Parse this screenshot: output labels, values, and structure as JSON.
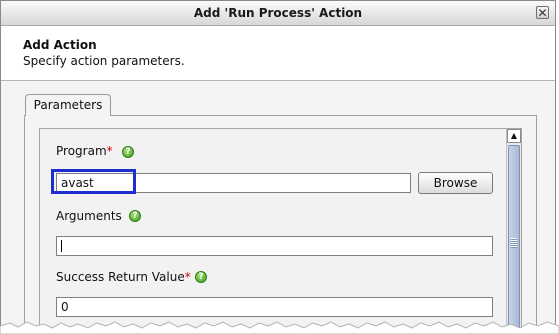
{
  "window": {
    "title": "Add 'Run Process' Action",
    "close_glyph": "✕"
  },
  "header": {
    "title": "Add Action",
    "subtitle": "Specify action parameters."
  },
  "tabs": [
    {
      "label": "Parameters"
    }
  ],
  "form": {
    "program": {
      "label": "Program",
      "required_mark": "*",
      "value": "avast",
      "browse_label": "Browse"
    },
    "arguments": {
      "label": "Arguments",
      "value": ""
    },
    "success_return": {
      "label": "Success Return Value",
      "required_mark": "*",
      "value": "0"
    }
  },
  "icons": {
    "help": "help-icon",
    "scroll_up": "scroll-up-arrow-icon"
  },
  "colors": {
    "highlight": "#1f2fcf",
    "help_green": "#3b9a1a",
    "required": "#cc0000"
  }
}
